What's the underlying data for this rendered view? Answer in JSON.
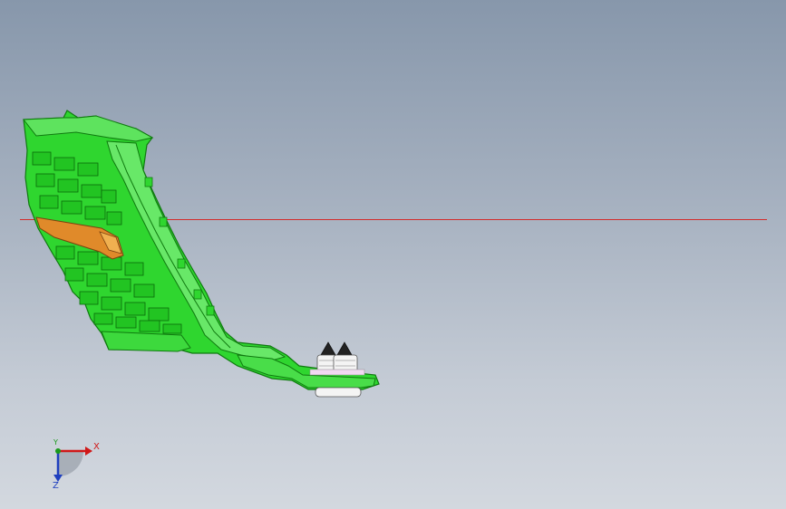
{
  "viewport": {
    "background_top": "#8797ab",
    "background_bottom": "#d3d8df"
  },
  "section_line": {
    "color": "#d42a2a"
  },
  "model": {
    "part_color": "#2fd62f",
    "part_edge_color": "#0f7a0f",
    "insert_color": "#e08a2a",
    "fastener_color": "#f4f4f4"
  },
  "triad": {
    "x_label": "X",
    "y_label": "Y",
    "z_label": "Z",
    "x_color": "#d01818",
    "y_color": "#1a9a1a",
    "z_color": "#1f3fbf"
  }
}
